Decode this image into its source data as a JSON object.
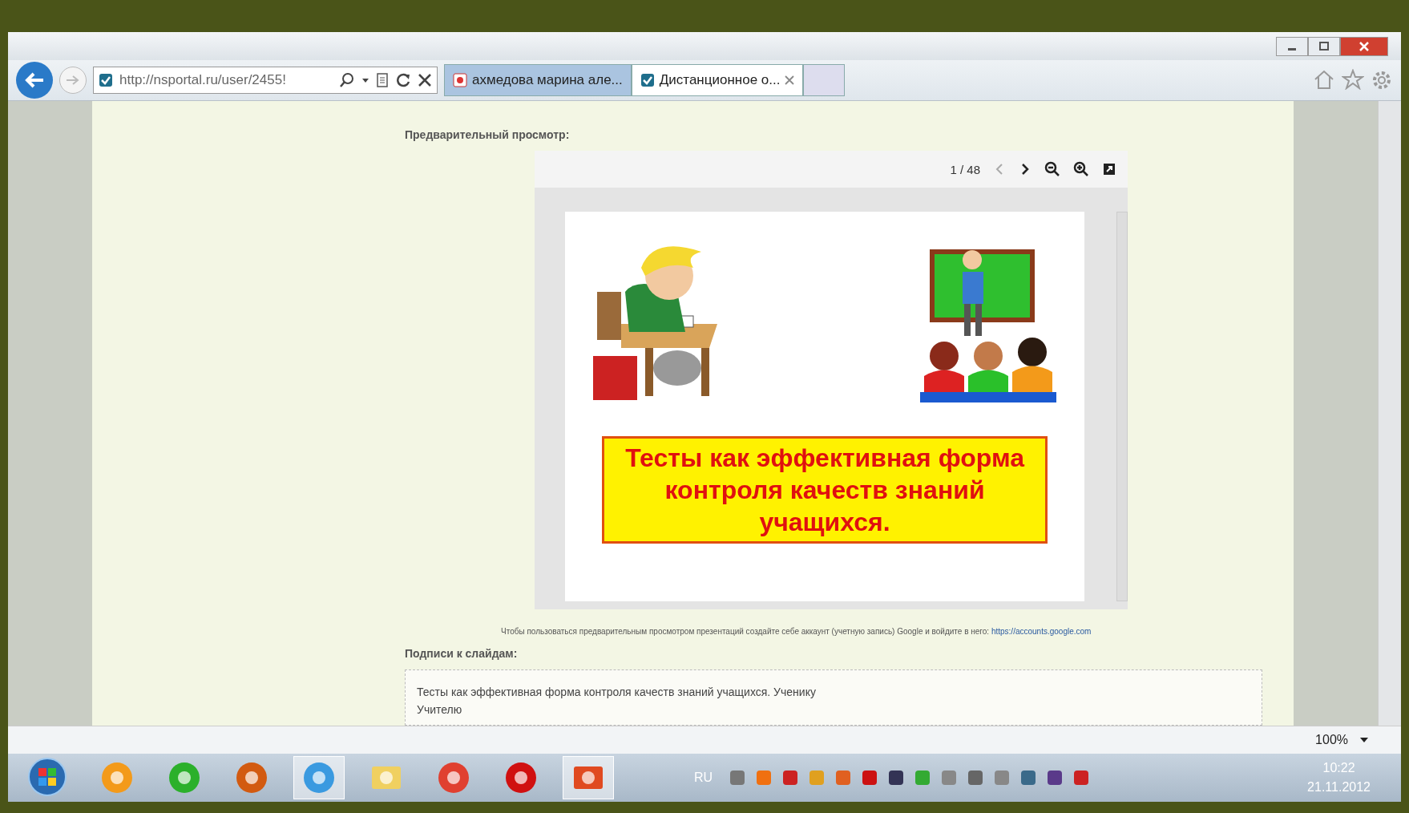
{
  "browser": {
    "url": "http://nsportal.ru/user/2455!",
    "tabs": [
      {
        "label": "ахмедова марина але...",
        "selected": false
      },
      {
        "label": "Дистанционное о...",
        "selected": true
      }
    ],
    "zoom": "100%"
  },
  "page": {
    "preview_label": "Предварительный просмотр:",
    "viewer": {
      "page_counter": "1 / 48",
      "slide_title": "Тесты как эффективная форма контроля качеств знаний учащихся."
    },
    "notice": "Чтобы пользоваться предварительным просмотром презентаций создайте себе аккаунт (учетную запись) Google и войдите в него:",
    "notice_link": "https://accounts.google.com",
    "captions_label": "Подписи к слайдам:",
    "captions": [
      "Тесты как эффективная форма контроля качеств знаний учащихся. Ученику",
      "Учителю"
    ]
  },
  "taskbar": {
    "language": "RU",
    "time": "10:22",
    "date": "21.11.2012"
  }
}
